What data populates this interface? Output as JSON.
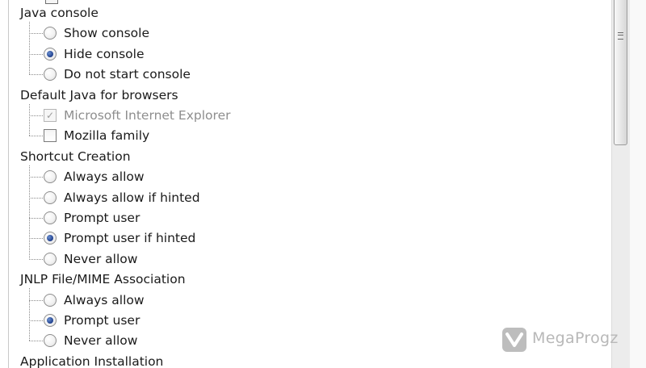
{
  "groups": [
    {
      "label": "Java console",
      "type": "radio",
      "options": [
        {
          "label": "Show console",
          "checked": false
        },
        {
          "label": "Hide console",
          "checked": true
        },
        {
          "label": "Do not start console",
          "checked": false
        }
      ]
    },
    {
      "label": "Default Java for browsers",
      "type": "checkbox",
      "options": [
        {
          "label": "Microsoft Internet Explorer",
          "checked": true,
          "disabled": true
        },
        {
          "label": "Mozilla family",
          "checked": false,
          "disabled": false
        }
      ]
    },
    {
      "label": "Shortcut Creation",
      "type": "radio",
      "options": [
        {
          "label": "Always allow",
          "checked": false
        },
        {
          "label": "Always allow if hinted",
          "checked": false
        },
        {
          "label": "Prompt user",
          "checked": false
        },
        {
          "label": "Prompt user if hinted",
          "checked": true
        },
        {
          "label": "Never allow",
          "checked": false
        }
      ]
    },
    {
      "label": "JNLP File/MIME Association",
      "type": "radio",
      "options": [
        {
          "label": "Always allow",
          "checked": false
        },
        {
          "label": "Prompt user",
          "checked": true
        },
        {
          "label": "Never allow",
          "checked": false
        }
      ]
    },
    {
      "label": "Application Installation",
      "type": "radio",
      "options": []
    }
  ],
  "watermark": {
    "text": "MegaProgz",
    "icon": "megaprogz-logo-icon"
  }
}
